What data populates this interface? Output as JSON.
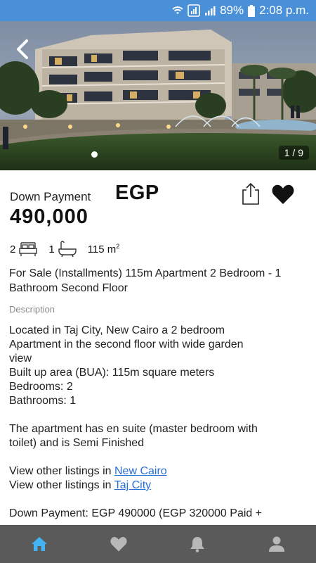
{
  "status_bar": {
    "battery": "89%",
    "time": "2:08 p.m."
  },
  "gallery": {
    "counter": "1 / 9"
  },
  "listing": {
    "down_payment_label": "Down Payment",
    "currency": "EGP",
    "price": "490,000",
    "bedrooms": "2",
    "bathrooms": "1",
    "area_value": "115 m",
    "area_exp": "2",
    "title": "For Sale (Installments) 115m Apartment 2 Bedroom - 1 Bathroom Second Floor"
  },
  "description": {
    "label": "Description",
    "line1": "Located in Taj City, New Cairo a 2 bedroom",
    "line2": "Apartment in the second floor with wide garden",
    "line3": "view",
    "line4": "Built up area (BUA): 115m square meters",
    "line5": "Bedrooms: 2",
    "line6": "Bathrooms: 1",
    "line7": "The apartment has en suite (master bedroom with",
    "line8": "toilet) and is Semi Finished",
    "view_other_prefix": "View other listings in ",
    "link_area": "New Cairo",
    "link_compound": "Taj City",
    "line9": "Down Payment: EGP 490000 (EGP 320000 Paid +"
  },
  "colors": {
    "status_bar": "#4a90d9",
    "nav_bar": "#5a5a5a",
    "nav_active": "#42b4f5",
    "link": "#2a6fd6"
  },
  "nav": {
    "items": [
      "home-icon",
      "heart-icon",
      "bell-icon",
      "person-icon"
    ],
    "active": "home-icon"
  }
}
